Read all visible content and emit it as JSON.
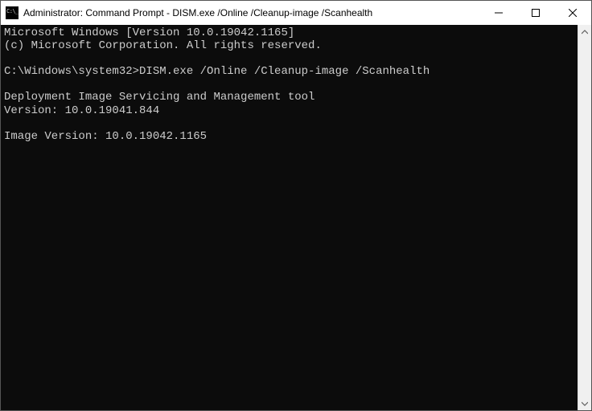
{
  "window": {
    "title": "Administrator: Command Prompt - DISM.exe  /Online /Cleanup-image /Scanhealth"
  },
  "terminal": {
    "lines": [
      "Microsoft Windows [Version 10.0.19042.1165]",
      "(c) Microsoft Corporation. All rights reserved.",
      "",
      "C:\\Windows\\system32>DISM.exe /Online /Cleanup-image /Scanhealth",
      "",
      "Deployment Image Servicing and Management tool",
      "Version: 10.0.19041.844",
      "",
      "Image Version: 10.0.19042.1165",
      ""
    ]
  }
}
